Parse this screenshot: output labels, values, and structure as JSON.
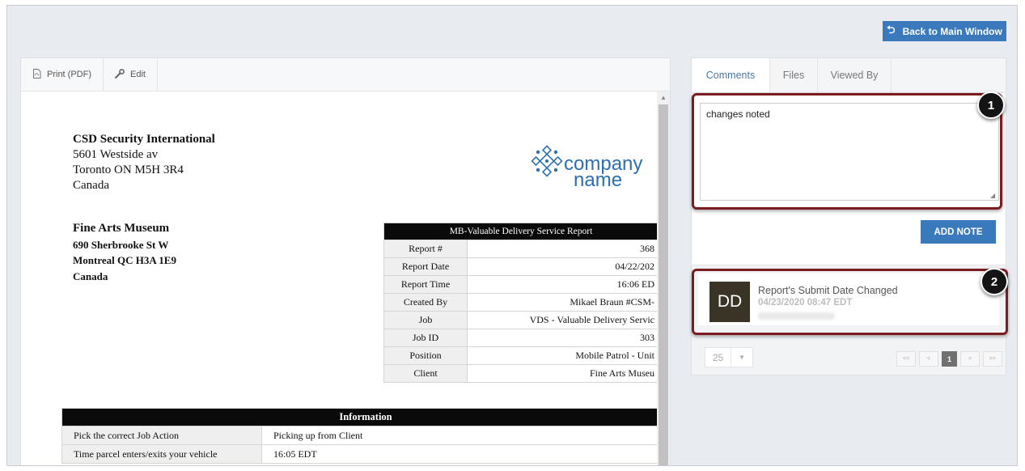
{
  "back_button_label": "Back to Main Window",
  "toolbar": {
    "print_label": "Print (PDF)",
    "edit_label": "Edit"
  },
  "report": {
    "company": {
      "name": "CSD Security International",
      "address_1": "5601 Westside av",
      "address_2": "Toronto ON M5H 3R4",
      "country": "Canada"
    },
    "client": {
      "name": "Fine Arts Museum",
      "address_1": "690 Sherbrooke St W",
      "address_2": "Montreal QC H3A 1E9",
      "country": "Canada"
    },
    "logo": {
      "line1": "company",
      "line2": "name"
    },
    "details_title": "MB-Valuable Delivery Service Report",
    "details": [
      {
        "label": "Report #",
        "value": "368"
      },
      {
        "label": "Report Date",
        "value": "04/22/202"
      },
      {
        "label": "Report Time",
        "value": "16:06 ED"
      },
      {
        "label": "Created By",
        "value": "Mikael Braun #CSM-"
      },
      {
        "label": "Job",
        "value": "VDS - Valuable Delivery Servic"
      },
      {
        "label": "Job ID",
        "value": "303"
      },
      {
        "label": "Position",
        "value": "Mobile Patrol - Unit"
      },
      {
        "label": "Client",
        "value": "Fine Arts Museu"
      }
    ],
    "info_title": "Information",
    "info": [
      {
        "label": "Pick the correct Job Action",
        "value": "Picking up from Client"
      },
      {
        "label": "Time parcel enters/exits your vehicle",
        "value": "16:05 EDT"
      }
    ]
  },
  "side": {
    "tabs": [
      "Comments",
      "Files",
      "Viewed By"
    ],
    "comment_text": "changes noted",
    "add_note_label": "ADD NOTE",
    "note": {
      "avatar": "DD",
      "title": "Report's Submit Date Changed",
      "date": "04/23/2020 08:47 EDT"
    },
    "pagination": {
      "page_size": "25",
      "first": "<<",
      "prev": "<",
      "current": "1",
      "next": ">",
      "last": ">>"
    }
  },
  "callouts": [
    "1",
    "2"
  ],
  "colors": {
    "accent": "#3a79bb",
    "highlight": "#7d1c20",
    "avatar_bg": "#3a3427"
  }
}
